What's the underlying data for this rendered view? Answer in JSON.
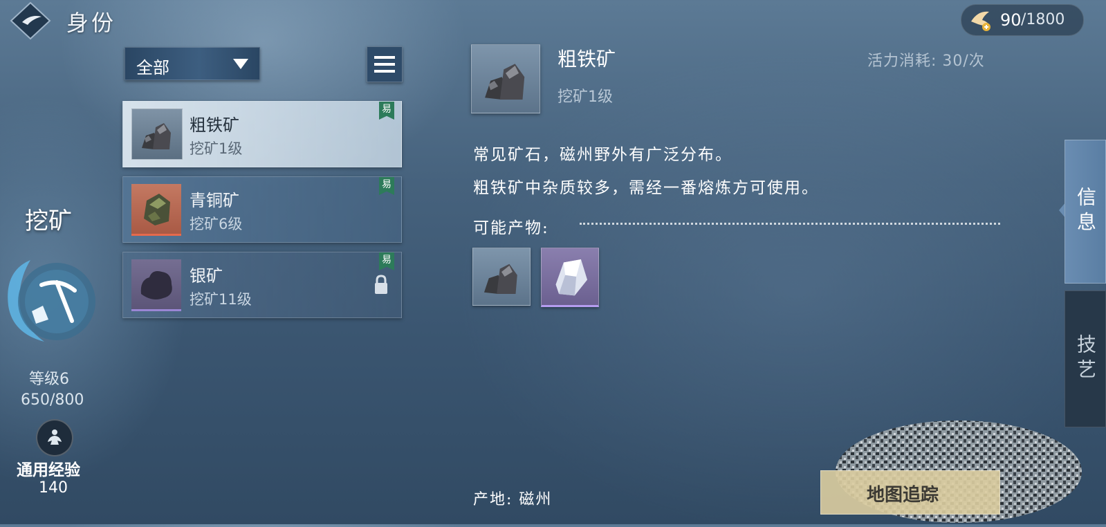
{
  "header": {
    "title": "身份",
    "back_icon": "back-diamond-icon"
  },
  "energy": {
    "icon": "crane-icon",
    "current": "90",
    "max": "/1800"
  },
  "skill": {
    "name": "挖矿",
    "emblem_icon": "pickaxe-emblem-icon",
    "level": "等级6",
    "exp": "650/800",
    "general_icon": "meditation-icon",
    "general_label": "通用经验",
    "general_value": "140"
  },
  "filter": {
    "label": "全部",
    "menu_icon": "hamburger-icon"
  },
  "ores": [
    {
      "name": "粗铁矿",
      "level": "挖矿1级",
      "badge": "易",
      "selected": true,
      "locked": false,
      "icon": "iron-ore-icon"
    },
    {
      "name": "青铜矿",
      "level": "挖矿6级",
      "badge": "易",
      "selected": false,
      "locked": false,
      "icon": "bronze-ore-icon"
    },
    {
      "name": "银矿",
      "level": "挖矿11级",
      "badge": "易",
      "selected": false,
      "locked": true,
      "icon": "silver-ore-icon"
    }
  ],
  "detail": {
    "name": "粗铁矿",
    "level": "挖矿1级",
    "vitality_cost": "活力消耗: 30/次",
    "description": [
      "常见矿石，磁州野外有广泛分布。",
      "粗铁矿中杂质较多，需经一番熔炼方可使用。"
    ],
    "products_label": "可能产物:",
    "products": [
      {
        "icon": "iron-ore-icon"
      },
      {
        "icon": "silver-crystal-icon"
      }
    ],
    "origin": "产地: 磁州"
  },
  "tabs": [
    {
      "label": "信息",
      "active": true
    },
    {
      "label": "技艺",
      "active": false
    }
  ],
  "map_button": {
    "label": "地图追踪"
  },
  "colors": {
    "easy_badge": "#2d7b5a",
    "selected_row": "#dfe9f1",
    "accent_tab": "#6a8db2"
  }
}
